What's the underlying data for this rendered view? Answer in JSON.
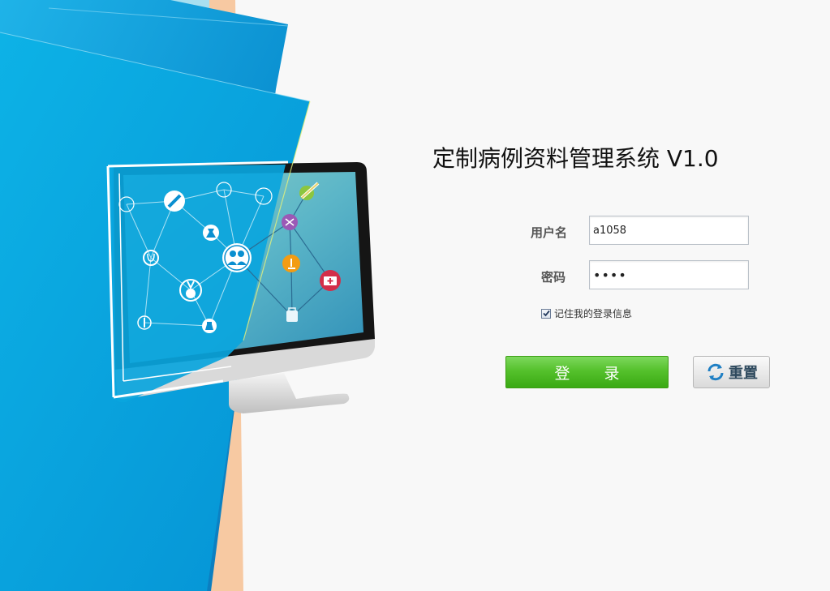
{
  "app": {
    "title": "定制病例资料管理系统 V1.0"
  },
  "login_form": {
    "username_label": "用户名",
    "username_value": "a1058",
    "password_label": "密码",
    "password_value": "••••",
    "remember_label": "记住我的登录信息",
    "remember_checked": true,
    "login_button_label": "登 录",
    "reset_button_label": "重置"
  },
  "colors": {
    "primary_blue": "#0a8fd0",
    "login_green": "#4fbc25",
    "peach_accent": "#f7c9a2"
  },
  "illustration": {
    "icons": [
      "pencil-icon",
      "stethoscope-icon",
      "medal-icon",
      "doctors-icon",
      "flask-icon",
      "syringe-icon",
      "microscope-icon",
      "scissors-icon",
      "medical-kit-icon",
      "bottle-icon",
      "pin-icon"
    ]
  }
}
